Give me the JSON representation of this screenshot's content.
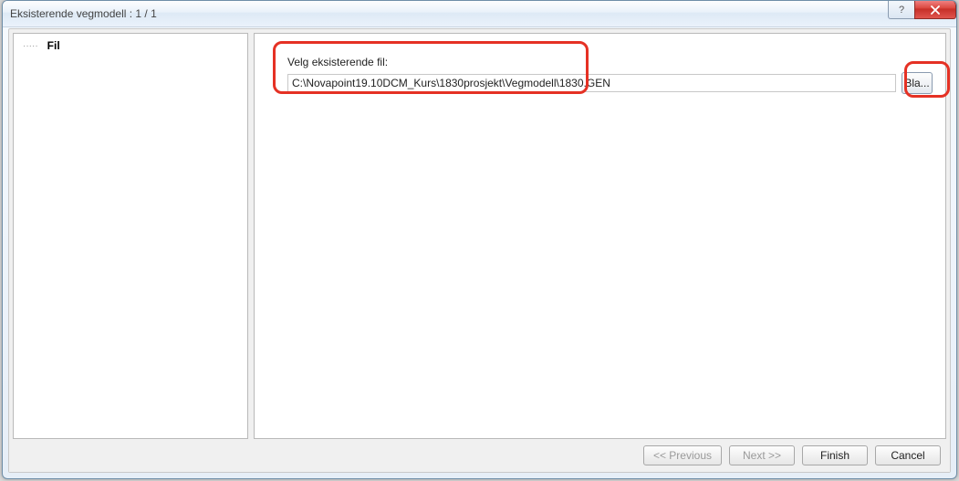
{
  "window": {
    "title": "Eksisterende vegmodell : 1 / 1",
    "help_glyph": "?",
    "close_glyph": "✕"
  },
  "sidebar": {
    "items": [
      {
        "label": "Fil"
      }
    ]
  },
  "main": {
    "select_label": "Velg eksisterende fil:",
    "path_value": "C:\\Novapoint19.10DCM_Kurs\\1830prosjekt\\Vegmodell\\1830.GEN",
    "browse_label": "Bla..."
  },
  "footer": {
    "previous_label": "<< Previous",
    "next_label": "Next >>",
    "finish_label": "Finish",
    "cancel_label": "Cancel"
  }
}
